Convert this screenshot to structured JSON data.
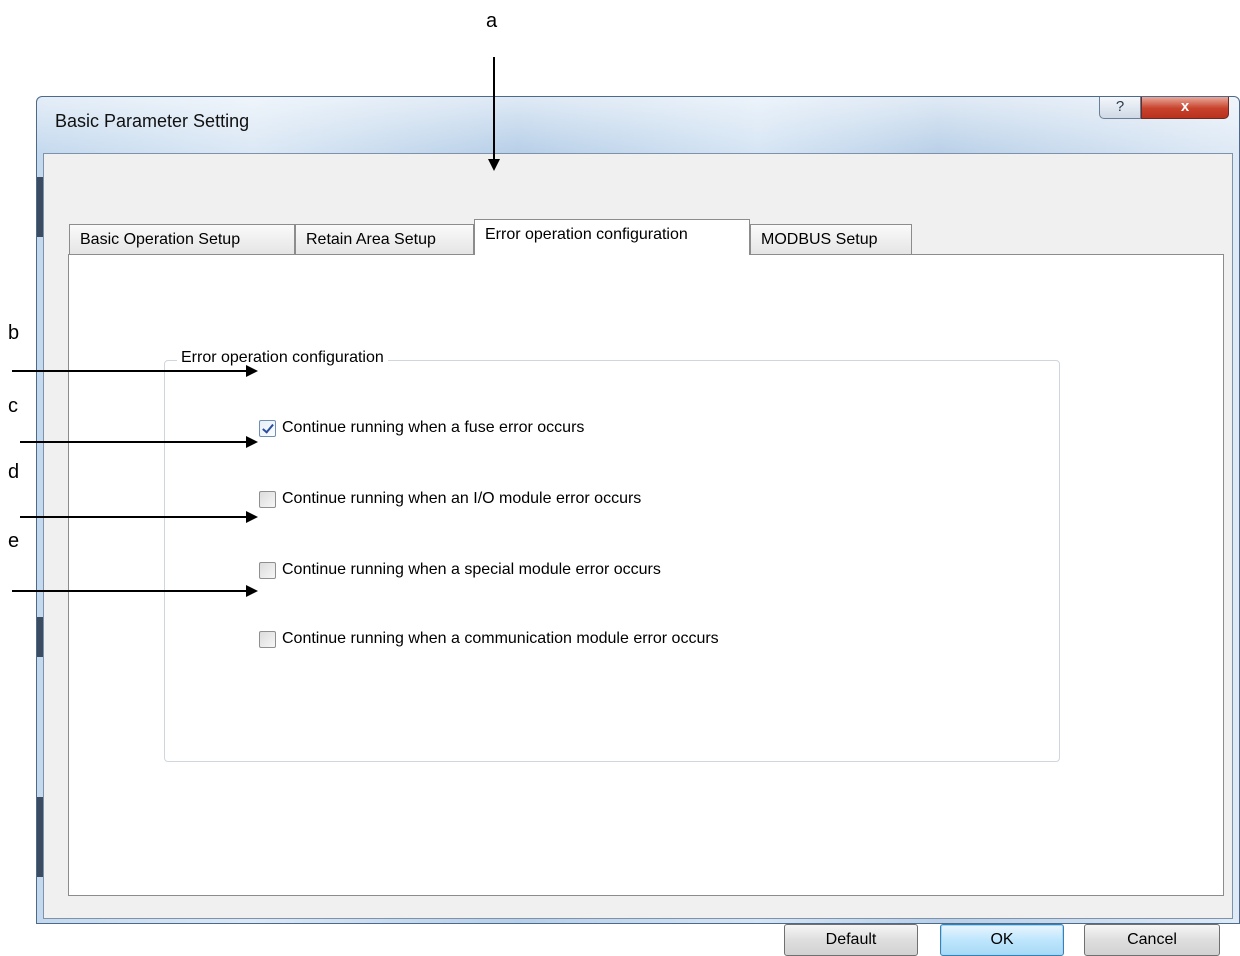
{
  "annotations": {
    "a": "a",
    "b": "b",
    "c": "c",
    "d": "d",
    "e": "e"
  },
  "window": {
    "title": "Basic Parameter Setting",
    "help_label": "?",
    "close_label": "x"
  },
  "tabs": [
    {
      "label": "Basic Operation Setup",
      "active": false
    },
    {
      "label": "Retain Area Setup",
      "active": false
    },
    {
      "label": "Error operation configuration",
      "active": true
    },
    {
      "label": "MODBUS Setup",
      "active": false
    }
  ],
  "group": {
    "title": "Error operation configuration",
    "options": [
      {
        "label": "Continue running when a fuse error occurs",
        "checked": true
      },
      {
        "label": "Continue running when an I/O module error occurs",
        "checked": false
      },
      {
        "label": "Continue running when a special module error occurs",
        "checked": false
      },
      {
        "label": "Continue running when a communication module error occurs",
        "checked": false
      }
    ]
  },
  "buttons": {
    "default": "Default",
    "ok": "OK",
    "cancel": "Cancel"
  },
  "colors": {
    "close": "#c7412b",
    "check": "#2b4ea0",
    "primary_button": "#bee6fd"
  }
}
